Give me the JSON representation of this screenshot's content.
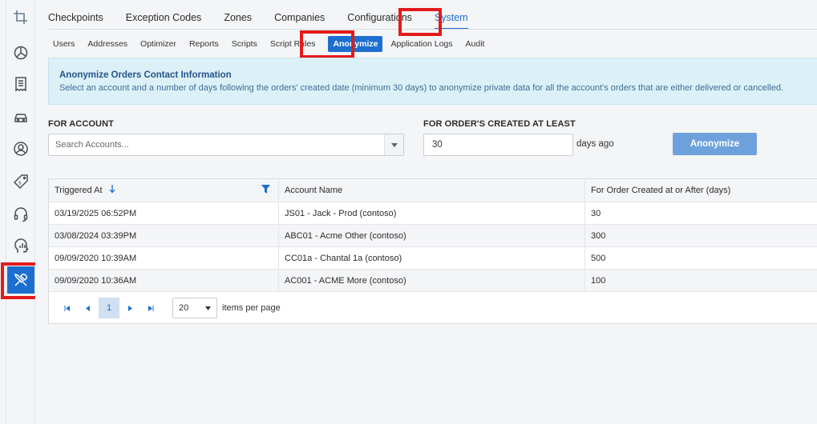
{
  "sidebar": {
    "items": [
      {
        "icon": "crop-icon"
      },
      {
        "icon": "pie-chart-icon"
      },
      {
        "icon": "receipt-icon"
      },
      {
        "icon": "car-icon"
      },
      {
        "icon": "user-icon"
      },
      {
        "icon": "price-tag-icon"
      },
      {
        "icon": "headset-icon"
      },
      {
        "icon": "analytics-head-icon"
      },
      {
        "icon": "tools-icon",
        "active": true
      }
    ]
  },
  "top_tabs": [
    "Checkpoints",
    "Exception Codes",
    "Zones",
    "Companies",
    "Configurations",
    "System"
  ],
  "top_tab_active": "System",
  "sub_tabs": [
    "Users",
    "Addresses",
    "Optimizer",
    "Reports",
    "Scripts",
    "Script Rules",
    "Anonymize",
    "Application Logs",
    "Audit"
  ],
  "sub_tab_active": "Anonymize",
  "info": {
    "title": "Anonymize Orders Contact Information",
    "text": "Select an account and a number of days following the orders' created date (minimum 30 days) to anonymize private data for all the account's orders that are either delivered or cancelled."
  },
  "form": {
    "account_label": "FOR ACCOUNT",
    "account_placeholder": "Search Accounts...",
    "days_label": "FOR ORDER'S CREATED AT LEAST",
    "days_value": "30",
    "days_suffix": "days ago",
    "button_label": "Anonymize"
  },
  "grid": {
    "columns": [
      "Triggered At",
      "Account Name",
      "For Order Created at or After (days)"
    ],
    "rows": [
      [
        "03/19/2025 06:52PM",
        "JS01 - Jack - Prod (contoso)",
        "30"
      ],
      [
        "03/08/2024 03:39PM",
        "ABC01 - Acme Other (contoso)",
        "300"
      ],
      [
        "09/09/2020 10:39AM",
        "CC01a - Chantal 1a (contoso)",
        "500"
      ],
      [
        "09/09/2020 10:36AM",
        "AC001 - ACME More (contoso)",
        "100"
      ]
    ],
    "pager": {
      "current_page": "1",
      "page_size": "20",
      "page_size_label": "items per page"
    }
  },
  "colors": {
    "accent": "#1d6fcf",
    "highlight": "#e31b1b",
    "info_bg": "#dcf0f8",
    "button_disabled": "#6ea1dc"
  }
}
